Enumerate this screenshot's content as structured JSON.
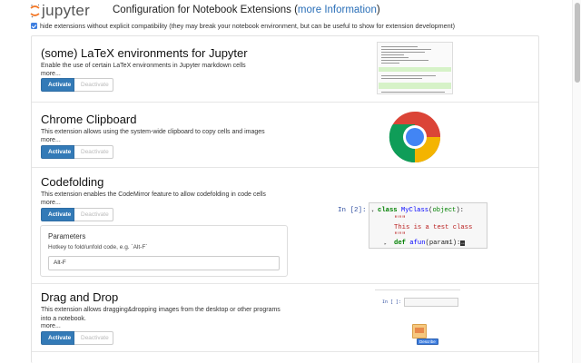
{
  "header": {
    "logo_text": "jupyter",
    "title_prefix": "Configuration for Notebook Extensions (",
    "title_link": "more Information",
    "title_suffix": ")"
  },
  "compat_label": "hide extensions without explicit compatibility (they may break your notebook environment, but can be useful to show for extension development)",
  "buttons": {
    "activate": "Activate",
    "deactivate": "Deactivate"
  },
  "extensions": [
    {
      "title": "(some) LaTeX environments for Jupyter",
      "description": "Enable the use of certain LaTeX environments in Jupyter markdown cells",
      "more": "more..."
    },
    {
      "title": "Chrome Clipboard",
      "description": "This extension allows using the system-wide clipboard to copy cells and images",
      "more": "more..."
    },
    {
      "title": "Codefolding",
      "description": "This extension enables the CodeMirror feature to allow codefolding in code cells",
      "more": "more...",
      "params": {
        "title": "Parameters",
        "hint": "Hotkey to fold/unfold code, e.g. `Alt-F`",
        "value": "Alt-F"
      },
      "code_sample": {
        "prompt": "In [2]:",
        "lines": [
          "class MyClass(object):",
          "\"\"\"",
          "This is a test class",
          "\"\"\"",
          "def afun(param1):"
        ]
      }
    },
    {
      "title": "Drag and Drop",
      "description": "This extension allows dragging&dropping images from the desktop or other programs into a notebook.",
      "more": "more...",
      "preview": {
        "prompt": "In [ ]:",
        "badge": "Describe"
      }
    }
  ],
  "colors": {
    "accent": "#337ab7",
    "link": "#2a6fb8",
    "logo_orange": "#f37726"
  }
}
